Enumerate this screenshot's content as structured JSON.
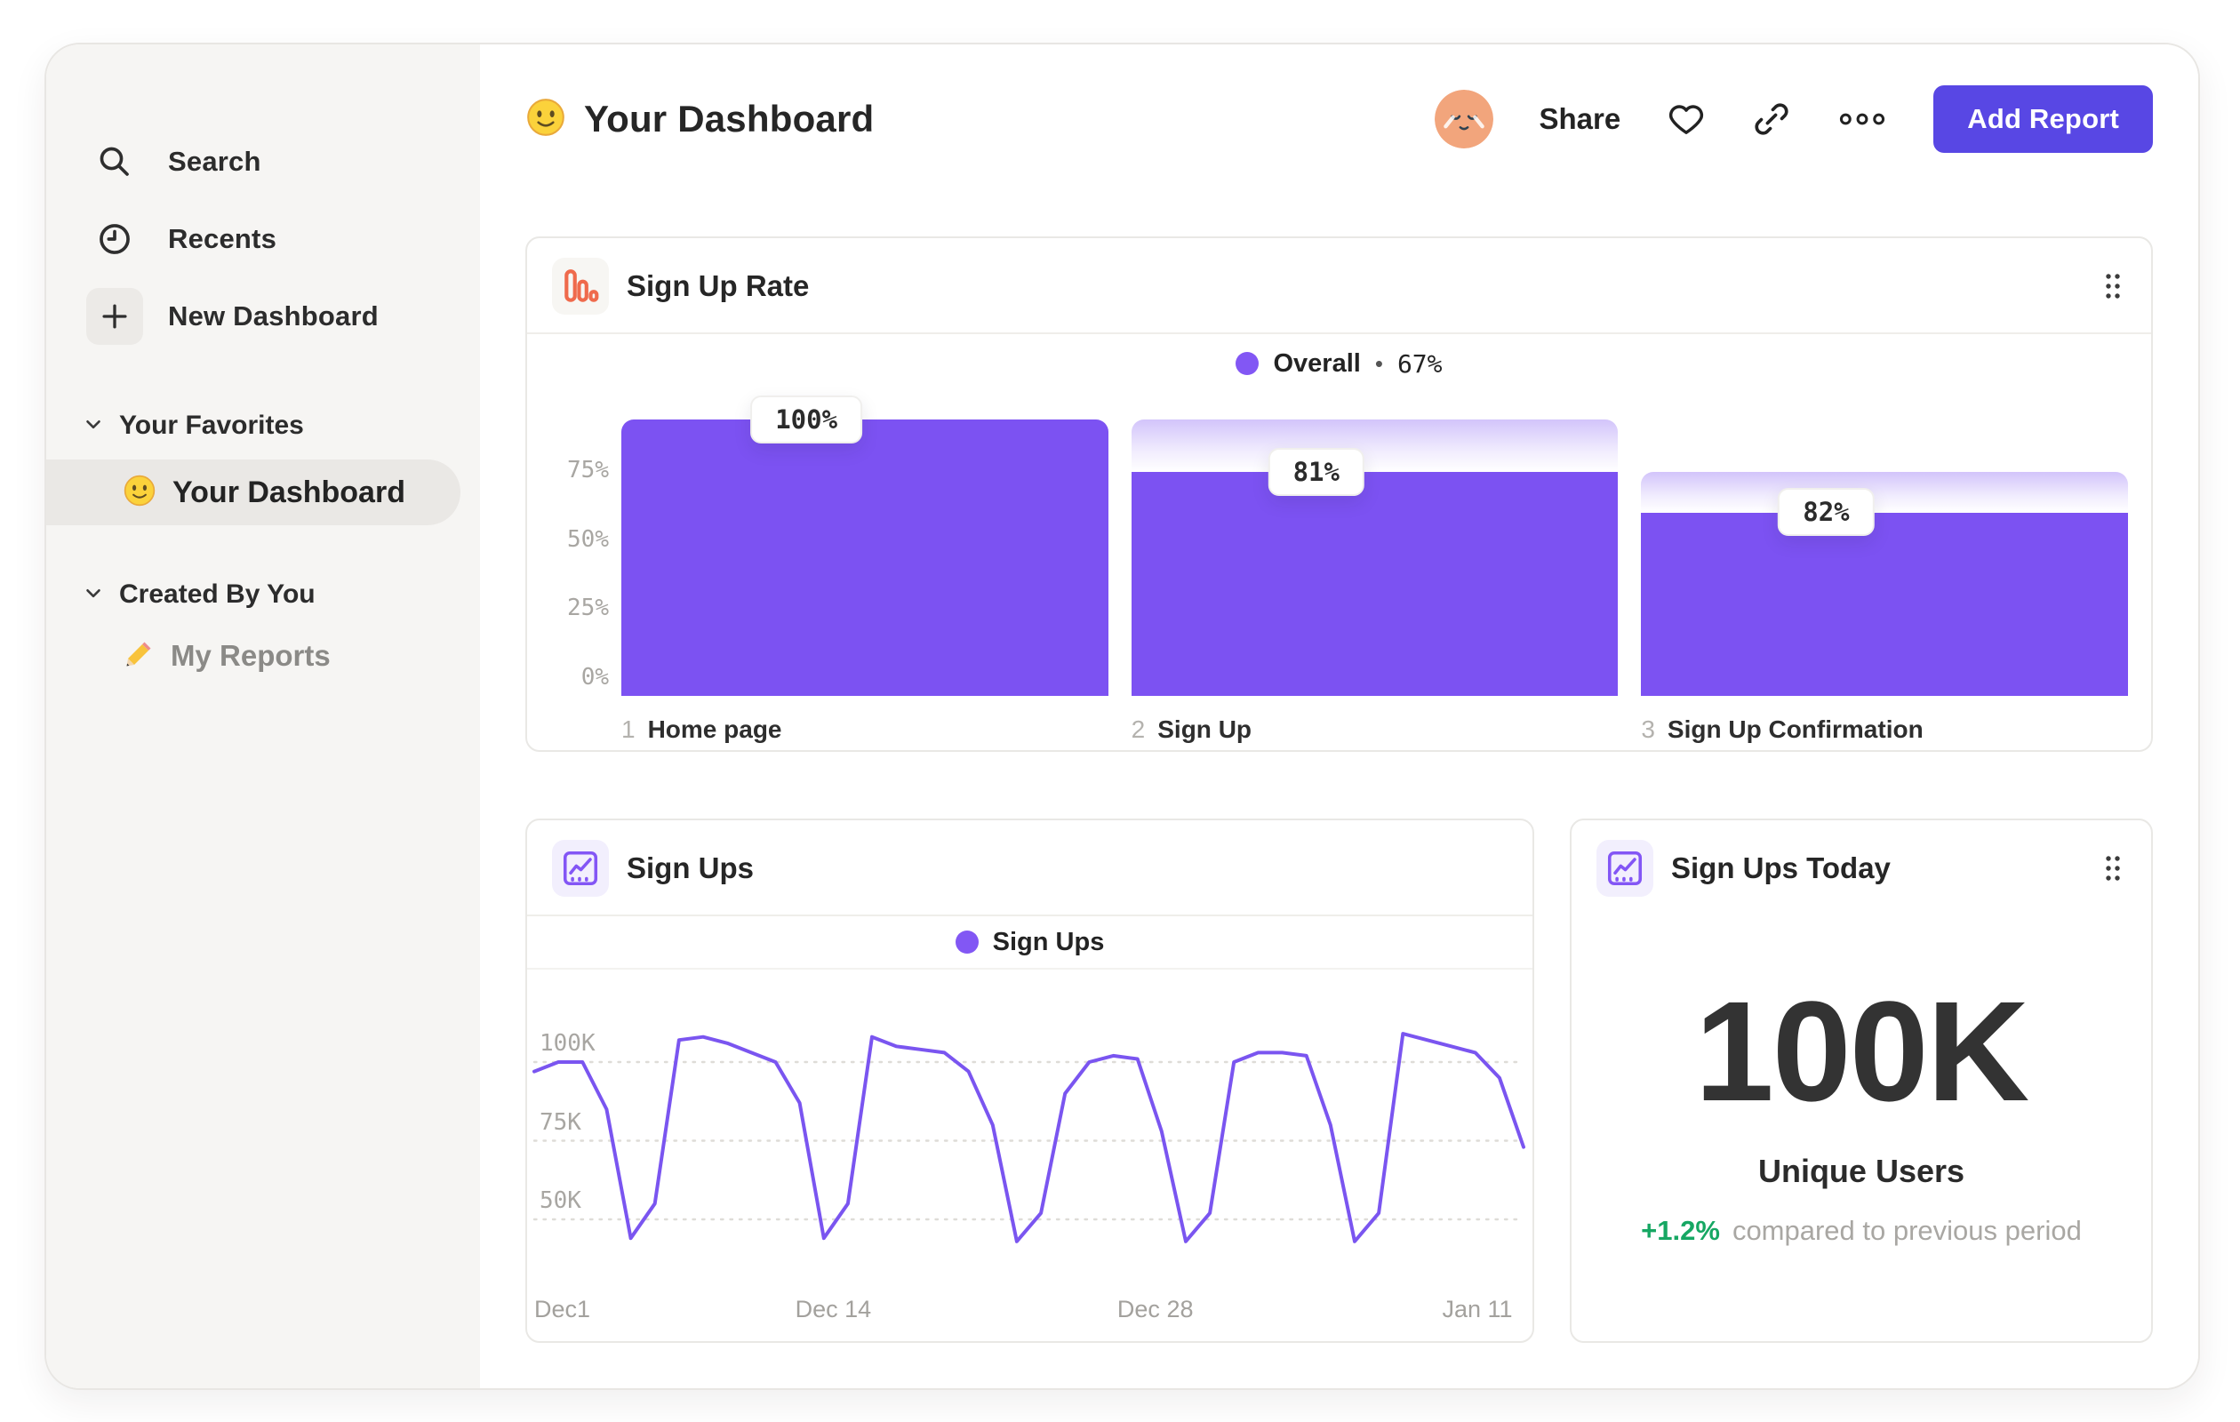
{
  "sidebar": {
    "items": [
      {
        "label": "Search"
      },
      {
        "label": "Recents"
      },
      {
        "label": "New Dashboard"
      }
    ],
    "sections": [
      {
        "label": "Your Favorites"
      },
      {
        "label": "Created By You"
      }
    ],
    "favorite_item": {
      "label": "Your Dashboard"
    },
    "created_item": {
      "label": "My Reports"
    }
  },
  "header": {
    "title": "Your Dashboard",
    "share_label": "Share",
    "add_report_label": "Add Report"
  },
  "cards": {
    "signup_rate": {
      "title": "Sign Up Rate",
      "legend_label": "Overall",
      "legend_sep": "•",
      "legend_value": "67%"
    },
    "signups": {
      "title": "Sign Ups",
      "legend_label": "Sign Ups"
    },
    "signups_today": {
      "title": "Sign Ups Today",
      "value": "100K",
      "subtitle": "Unique Users",
      "delta": "+1.2%",
      "delta_caption": "compared to previous period"
    }
  },
  "chart_data": [
    {
      "type": "bar",
      "name": "signup-rate-funnel",
      "title": "Sign Up Rate",
      "legend": "Overall",
      "overall_conversion": "67%",
      "ylim": [
        0,
        100
      ],
      "yticks": [
        {
          "label": "75%",
          "value": 75
        },
        {
          "label": "50%",
          "value": 50
        },
        {
          "label": "25%",
          "value": 25
        },
        {
          "label": "0%",
          "value": 0
        }
      ],
      "steps": [
        {
          "index": "1",
          "label": "Home page",
          "value_label": "100%",
          "conversion_pct": 100,
          "cumulative_pct": 100
        },
        {
          "index": "2",
          "label": "Sign Up",
          "value_label": "81%",
          "conversion_pct": 81,
          "cumulative_pct": 81
        },
        {
          "index": "3",
          "label": "Sign Up Confirmation",
          "value_label": "82%",
          "conversion_pct": 82,
          "cumulative_pct": 66.4
        }
      ]
    },
    {
      "type": "line",
      "name": "signups-daily",
      "title": "Sign Ups",
      "legend": "Sign Ups",
      "ylabel_unit": "K",
      "yticks": [
        {
          "label": "100K",
          "value": 100
        },
        {
          "label": "75K",
          "value": 75
        },
        {
          "label": "50K",
          "value": 50
        }
      ],
      "x_tick_labels": [
        "Dec1",
        "Dec 14",
        "Dec 28",
        "Jan 11"
      ],
      "x_tick_indices": [
        0,
        13,
        27,
        41
      ],
      "values_thousands": [
        97,
        100,
        100,
        85,
        44,
        55,
        107,
        108,
        106,
        103,
        100,
        87,
        44,
        55,
        108,
        105,
        104,
        103,
        97,
        80,
        43,
        52,
        90,
        100,
        102,
        101,
        78,
        43,
        52,
        100,
        103,
        103,
        102,
        80,
        43,
        52,
        109,
        107,
        105,
        103,
        95,
        73
      ]
    },
    {
      "type": "stat",
      "name": "signups-today",
      "title": "Sign Ups Today",
      "value": "100K",
      "label": "Unique Users",
      "delta_pct": "+1.2%",
      "comparison": "compared to previous period"
    }
  ],
  "colors": {
    "accent_purple": "#7C52F2",
    "line_purple": "#7A55F0",
    "legend_dot_purple": "#8257F4",
    "button_purple": "#5847E4",
    "funnel_icon_orange": "#EF6A4C",
    "trend_icon_purple": "#8356F5",
    "positive_green": "#16A763"
  }
}
